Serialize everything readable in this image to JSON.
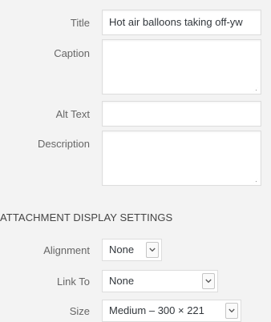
{
  "details": {
    "title_label": "Title",
    "title_value": "Hot air balloons taking off-yw",
    "caption_label": "Caption",
    "caption_value": "",
    "alt_label": "Alt Text",
    "alt_value": "",
    "description_label": "Description",
    "description_value": ""
  },
  "display_settings": {
    "heading": "ATTACHMENT DISPLAY SETTINGS",
    "alignment_label": "Alignment",
    "alignment_value": "None",
    "link_label": "Link To",
    "link_value": "None",
    "size_label": "Size",
    "size_value": "Medium – 300 × 221"
  },
  "icons": {
    "dropdown": "chevron-down-icon",
    "resize": "resize-handle-icon"
  }
}
